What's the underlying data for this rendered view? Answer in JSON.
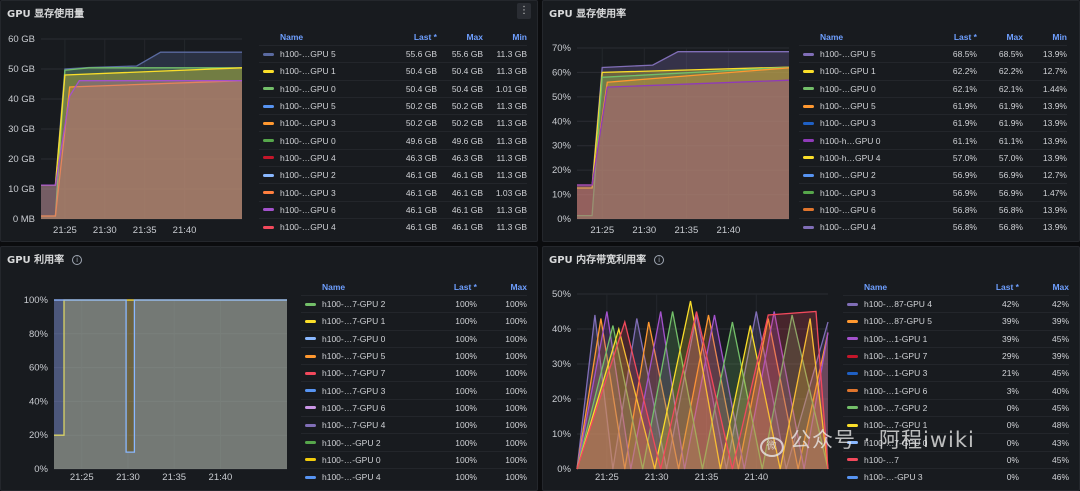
{
  "theme": {
    "background": "#181b1f",
    "header_color": "#6e9fff"
  },
  "panels": [
    {
      "title": "GPU 显存使用量",
      "has_menu": true,
      "menu_icon": "⋮",
      "has_info": false,
      "legend_columns": [
        "Name",
        "Last *",
        "Max",
        "Min"
      ],
      "legend_rows": [
        {
          "name": "h100-…GPU 5",
          "color": "#5a6aa0",
          "vals": [
            "55.6 GB",
            "55.6 GB",
            "11.3 GB"
          ]
        },
        {
          "name": "h100-…GPU 1",
          "color": "#fade2a",
          "vals": [
            "50.4 GB",
            "50.4 GB",
            "11.3 GB"
          ]
        },
        {
          "name": "h100-…GPU 0",
          "color": "#73bf69",
          "vals": [
            "50.4 GB",
            "50.4 GB",
            "1.01 GB"
          ]
        },
        {
          "name": "h100-…GPU 5",
          "color": "#5794f2",
          "vals": [
            "50.2 GB",
            "50.2 GB",
            "11.3 GB"
          ]
        },
        {
          "name": "h100-…GPU 3",
          "color": "#ff9830",
          "vals": [
            "50.2 GB",
            "50.2 GB",
            "11.3 GB"
          ]
        },
        {
          "name": "h100-…GPU 0",
          "color": "#56a64b",
          "vals": [
            "49.6 GB",
            "49.6 GB",
            "11.3 GB"
          ]
        },
        {
          "name": "h100-…GPU 4",
          "color": "#c4162a",
          "vals": [
            "46.3 GB",
            "46.3 GB",
            "11.3 GB"
          ]
        },
        {
          "name": "h100-…GPU 2",
          "color": "#8ab8ff",
          "vals": [
            "46.1 GB",
            "46.1 GB",
            "11.3 GB"
          ]
        },
        {
          "name": "h100-…GPU 3",
          "color": "#ff7f3f",
          "vals": [
            "46.1 GB",
            "46.1 GB",
            "1.03 GB"
          ]
        },
        {
          "name": "h100-…GPU 6",
          "color": "#a352cc",
          "vals": [
            "46.1 GB",
            "46.1 GB",
            "11.3 GB"
          ]
        },
        {
          "name": "h100-…GPU 4",
          "color": "#f2495c",
          "vals": [
            "46.1 GB",
            "46.1 GB",
            "11.3 GB"
          ]
        }
      ]
    },
    {
      "title": "GPU 显存使用率",
      "has_menu": false,
      "has_info": false,
      "legend_columns": [
        "Name",
        "Last *",
        "Max",
        "Min"
      ],
      "legend_rows": [
        {
          "name": "h100-…GPU 5",
          "color": "#806eb7",
          "vals": [
            "68.5%",
            "68.5%",
            "13.9%"
          ]
        },
        {
          "name": "h100-…GPU 1",
          "color": "#fade2a",
          "vals": [
            "62.2%",
            "62.2%",
            "12.7%"
          ]
        },
        {
          "name": "h100-…GPU 0",
          "color": "#73bf69",
          "vals": [
            "62.1%",
            "62.1%",
            "1.44%"
          ]
        },
        {
          "name": "h100-…GPU 5",
          "color": "#ff9830",
          "vals": [
            "61.9%",
            "61.9%",
            "13.9%"
          ]
        },
        {
          "name": "h100-…GPU 3",
          "color": "#1f60c4",
          "vals": [
            "61.9%",
            "61.9%",
            "13.9%"
          ]
        },
        {
          "name": "h100-h…GPU 0",
          "color": "#8f3bb8",
          "vals": [
            "61.1%",
            "61.1%",
            "13.9%"
          ]
        },
        {
          "name": "h100-h…GPU 4",
          "color": "#fade2a",
          "vals": [
            "57.0%",
            "57.0%",
            "13.9%"
          ]
        },
        {
          "name": "h100-…GPU 2",
          "color": "#5794f2",
          "vals": [
            "56.9%",
            "56.9%",
            "12.7%"
          ]
        },
        {
          "name": "h100-…GPU 3",
          "color": "#56a64b",
          "vals": [
            "56.9%",
            "56.9%",
            "1.47%"
          ]
        },
        {
          "name": "h100-…GPU 6",
          "color": "#e0752d",
          "vals": [
            "56.8%",
            "56.8%",
            "13.9%"
          ]
        },
        {
          "name": "h100-…GPU 4",
          "color": "#806eb7",
          "vals": [
            "56.8%",
            "56.8%",
            "13.9%"
          ]
        }
      ]
    },
    {
      "title": "GPU 利用率",
      "has_menu": false,
      "has_info": true,
      "info_icon": "i",
      "legend_columns": [
        "Name",
        "Last *",
        "Max"
      ],
      "legend_rows": [
        {
          "name": "h100-…7-GPU 2",
          "color": "#73bf69",
          "vals": [
            "100%",
            "100%"
          ]
        },
        {
          "name": "h100-…7-GPU 1",
          "color": "#fade2a",
          "vals": [
            "100%",
            "100%"
          ]
        },
        {
          "name": "h100-…7-GPU 0",
          "color": "#8ab8ff",
          "vals": [
            "100%",
            "100%"
          ]
        },
        {
          "name": "h100-…7-GPU 5",
          "color": "#ff9830",
          "vals": [
            "100%",
            "100%"
          ]
        },
        {
          "name": "h100-…7-GPU 7",
          "color": "#f2495c",
          "vals": [
            "100%",
            "100%"
          ]
        },
        {
          "name": "h100-…7-GPU 3",
          "color": "#5794f2",
          "vals": [
            "100%",
            "100%"
          ]
        },
        {
          "name": "h100-…7-GPU 6",
          "color": "#ca95e5",
          "vals": [
            "100%",
            "100%"
          ]
        },
        {
          "name": "h100-…7-GPU 4",
          "color": "#806eb7",
          "vals": [
            "100%",
            "100%"
          ]
        },
        {
          "name": "h100-…-GPU 2",
          "color": "#56a64b",
          "vals": [
            "100%",
            "100%"
          ]
        },
        {
          "name": "h100-…-GPU 0",
          "color": "#f2cc0c",
          "vals": [
            "100%",
            "100%"
          ]
        },
        {
          "name": "h100-…-GPU 4",
          "color": "#5794f2",
          "vals": [
            "100%",
            "100%"
          ]
        }
      ]
    },
    {
      "title": "GPU 内存带宽利用率",
      "has_menu": false,
      "has_info": true,
      "info_icon": "i",
      "legend_columns": [
        "Name",
        "Last *",
        "Max"
      ],
      "legend_rows": [
        {
          "name": "h100-…87-GPU 4",
          "color": "#806eb7",
          "vals": [
            "42%",
            "42%"
          ]
        },
        {
          "name": "h100-…87-GPU 5",
          "color": "#ff9830",
          "vals": [
            "39%",
            "39%"
          ]
        },
        {
          "name": "h100-…1-GPU 1",
          "color": "#a352cc",
          "vals": [
            "39%",
            "45%"
          ]
        },
        {
          "name": "h100-…1-GPU 7",
          "color": "#c4162a",
          "vals": [
            "29%",
            "39%"
          ]
        },
        {
          "name": "h100-…1-GPU 3",
          "color": "#1f60c4",
          "vals": [
            "21%",
            "45%"
          ]
        },
        {
          "name": "h100-…1-GPU 6",
          "color": "#e0752d",
          "vals": [
            "3%",
            "40%"
          ]
        },
        {
          "name": "h100-…7-GPU 2",
          "color": "#73bf69",
          "vals": [
            "0%",
            "45%"
          ]
        },
        {
          "name": "h100-…7-GPU 1",
          "color": "#fade2a",
          "vals": [
            "0%",
            "48%"
          ]
        },
        {
          "name": "h100-…7-GPU 0",
          "color": "#8ab8ff",
          "vals": [
            "0%",
            "43%"
          ]
        },
        {
          "name": "h100-…7",
          "color": "#f2495c",
          "vals": [
            "0%",
            "45%"
          ]
        },
        {
          "name": "h100-…-GPU 3",
          "color": "#5794f2",
          "vals": [
            "0%",
            "46%"
          ]
        }
      ]
    }
  ],
  "chart_data": [
    {
      "type": "area",
      "title": "GPU 显存使用量",
      "ytick_labels": [
        "0 MB",
        "10 GB",
        "20 GB",
        "30 GB",
        "40 GB",
        "50 GB",
        "60 GB"
      ],
      "ylim": [
        0,
        60
      ],
      "x_ticks": [
        "21:25",
        "21:30",
        "21:35",
        "21:40"
      ],
      "xlim": [
        21.3,
        21.72
      ],
      "series": [
        {
          "color": "#5a6aa0",
          "x": [
            21.3,
            21.33,
            21.35,
            21.4,
            21.5,
            21.55,
            21.72
          ],
          "y": [
            11.3,
            11.3,
            50.0,
            50.5,
            51.0,
            55.6,
            55.6
          ]
        },
        {
          "color": "#73bf69",
          "x": [
            21.3,
            21.33,
            21.35,
            21.4,
            21.72
          ],
          "y": [
            1.0,
            1.0,
            49.6,
            50.4,
            50.4
          ]
        },
        {
          "color": "#fade2a",
          "x": [
            21.3,
            21.33,
            21.35,
            21.72
          ],
          "y": [
            11.3,
            11.3,
            48.0,
            50.4
          ]
        },
        {
          "color": "#ff9830",
          "x": [
            21.3,
            21.33,
            21.36,
            21.72
          ],
          "y": [
            1.0,
            1.0,
            44.0,
            46.1
          ]
        },
        {
          "color": "#a352cc",
          "x": [
            21.3,
            21.33,
            21.36,
            21.38,
            21.72
          ],
          "y": [
            11.3,
            11.3,
            41.0,
            46.1,
            46.1
          ]
        }
      ]
    },
    {
      "type": "area",
      "title": "GPU 显存使用率",
      "ytick_labels": [
        "0%",
        "10%",
        "20%",
        "30%",
        "40%",
        "50%",
        "60%",
        "70%"
      ],
      "ylim": [
        0,
        70
      ],
      "x_ticks": [
        "21:25",
        "21:30",
        "21:35",
        "21:40"
      ],
      "xlim": [
        21.3,
        21.72
      ],
      "series": [
        {
          "color": "#806eb7",
          "x": [
            21.3,
            21.33,
            21.35,
            21.45,
            21.5,
            21.72
          ],
          "y": [
            13.9,
            13.9,
            62.0,
            63.0,
            68.5,
            68.5
          ]
        },
        {
          "color": "#fade2a",
          "x": [
            21.3,
            21.33,
            21.35,
            21.72
          ],
          "y": [
            12.7,
            12.7,
            60.0,
            62.2
          ]
        },
        {
          "color": "#73bf69",
          "x": [
            21.3,
            21.33,
            21.35,
            21.72
          ],
          "y": [
            1.4,
            1.4,
            58.0,
            62.1
          ]
        },
        {
          "color": "#ff9830",
          "x": [
            21.3,
            21.33,
            21.36,
            21.72
          ],
          "y": [
            13.9,
            13.9,
            56.0,
            61.9
          ]
        },
        {
          "color": "#8f3bb8",
          "x": [
            21.3,
            21.33,
            21.36,
            21.72
          ],
          "y": [
            13.9,
            13.9,
            54.0,
            56.8
          ]
        }
      ]
    },
    {
      "type": "area",
      "title": "GPU 利用率",
      "ytick_labels": [
        "0%",
        "20%",
        "40%",
        "60%",
        "80%",
        "100%"
      ],
      "ylim": [
        0,
        100
      ],
      "x_ticks": [
        "21:25",
        "21:30",
        "21:35",
        "21:40"
      ],
      "xlim": [
        21.3,
        21.72
      ],
      "series": [
        {
          "color": "#806eb7",
          "x": [
            21.3,
            21.72
          ],
          "y": [
            100,
            100
          ]
        },
        {
          "color": "#fade2a",
          "x": [
            21.3,
            21.318,
            21.318,
            21.72
          ],
          "y": [
            20,
            20,
            100,
            100
          ]
        },
        {
          "color": "#8ab8ff",
          "x": [
            21.3,
            21.43,
            21.43,
            21.445,
            21.445,
            21.72
          ],
          "y": [
            100,
            100,
            10,
            10,
            100,
            100
          ]
        }
      ]
    },
    {
      "type": "area",
      "title": "GPU 内存带宽利用率",
      "ytick_labels": [
        "0%",
        "10%",
        "20%",
        "30%",
        "40%",
        "50%"
      ],
      "ylim": [
        0,
        50
      ],
      "x_ticks": [
        "21:25",
        "21:30",
        "21:35",
        "21:40"
      ],
      "xlim": [
        21.3,
        21.72
      ],
      "series": [
        {
          "color": "#806eb7",
          "x": [
            21.3,
            21.33,
            21.36,
            21.4,
            21.45,
            21.5,
            21.55,
            21.6,
            21.65,
            21.72
          ],
          "y": [
            0,
            44,
            0,
            43,
            0,
            44,
            0,
            45,
            0,
            42
          ]
        },
        {
          "color": "#ff9830",
          "x": [
            21.3,
            21.34,
            21.38,
            21.42,
            21.47,
            21.52,
            21.57,
            21.62,
            21.67,
            21.72
          ],
          "y": [
            0,
            43,
            0,
            42,
            0,
            44,
            0,
            43,
            0,
            39
          ]
        },
        {
          "color": "#a352cc",
          "x": [
            21.3,
            21.35,
            21.39,
            21.44,
            21.48,
            21.53,
            21.58,
            21.63,
            21.68,
            21.72
          ],
          "y": [
            0,
            45,
            0,
            45,
            0,
            44,
            0,
            45,
            0,
            39
          ]
        },
        {
          "color": "#73bf69",
          "x": [
            21.3,
            21.36,
            21.41,
            21.46,
            21.51,
            21.56,
            21.61,
            21.66,
            21.72
          ],
          "y": [
            0,
            41,
            0,
            45,
            0,
            42,
            0,
            44,
            0
          ]
        },
        {
          "color": "#fade2a",
          "x": [
            21.3,
            21.37,
            21.43,
            21.49,
            21.54,
            21.59,
            21.64,
            21.69,
            21.72
          ],
          "y": [
            0,
            40,
            0,
            48,
            0,
            41,
            0,
            43,
            0
          ]
        },
        {
          "color": "#f2495c",
          "x": [
            21.3,
            21.38,
            21.44,
            21.5,
            21.56,
            21.62,
            21.7,
            21.72
          ],
          "y": [
            0,
            42,
            0,
            45,
            0,
            44,
            45,
            0
          ]
        }
      ]
    }
  ],
  "watermark": {
    "logo": "微",
    "text": "公众号 · 阿程iwiki"
  }
}
